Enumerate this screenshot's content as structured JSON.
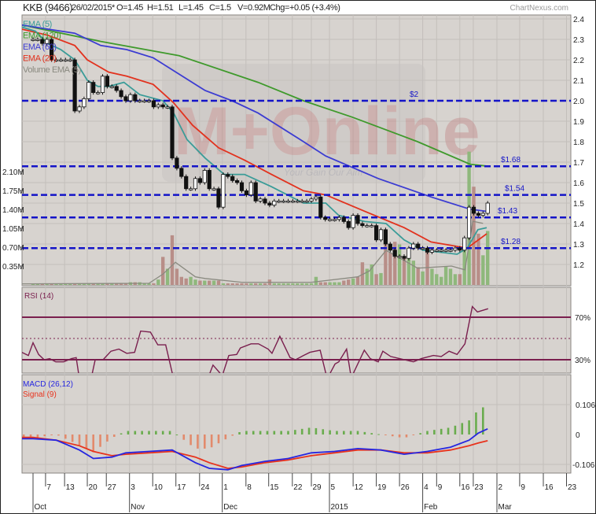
{
  "header": {
    "symbol": "KKB (9466)",
    "date": "26/02/2015*",
    "open": "O=1.45",
    "high": "H=1.51",
    "low": "L=1.45",
    "close": "C=1.5",
    "volume": "V=0.92M",
    "change": "Chg=+0.05 (+3.4%)",
    "brand": "ChartNexus.com"
  },
  "watermark": {
    "logo": "M+Online",
    "tagline": "Your Gain Our Aim"
  },
  "colors": {
    "panel_bg": "#d7d3cf",
    "grid": "#c3bfbb",
    "ema5": "#3a9c98",
    "ema120": "#3f9a2c",
    "ema60": "#3c3cd2",
    "ema20": "#e2321e",
    "vol_ema": "#8a8a80",
    "level": "#1414c8",
    "rsi": "#7a1f4e",
    "macd": "#2626e0",
    "signal": "#e8321c",
    "hist_pos": "#6aac4e",
    "hist_neg": "#e28a6c",
    "vol_up": "#8fb87c",
    "vol_down": "#b88e88"
  },
  "chart_data": [
    {
      "type": "candlestick",
      "title": "KKB (9466)",
      "x_unit": "trading day index from 1 Oct 2014",
      "legend": [
        {
          "label": "EMA (5)",
          "key": "ema5"
        },
        {
          "label": "EMA (120)",
          "key": "ema120"
        },
        {
          "label": "EMA (60)",
          "key": "ema60"
        },
        {
          "label": "EMA (20)",
          "key": "ema20"
        },
        {
          "label": "Volume EMA (5)",
          "key": "vol_ema"
        }
      ],
      "legend_placement": "top-left",
      "price_axis": {
        "ticks": [
          "2.4",
          "2.3",
          "2.2",
          "2.1",
          "2.0",
          "1.9",
          "1.8",
          "1.7",
          "1.6",
          "1.5",
          "1.4",
          "1.3",
          "1.2"
        ],
        "range": [
          1.15,
          2.42
        ]
      },
      "volume_axis": {
        "ticks": [
          "2.10M",
          "1.75M",
          "1.40M",
          "1.05M",
          "0.70M",
          "0.35M"
        ]
      },
      "levels": [
        {
          "price": 2.0,
          "label": "$2"
        },
        {
          "price": 1.68,
          "label": "$1.68"
        },
        {
          "price": 1.54,
          "label": "$1.54"
        },
        {
          "price": 1.43,
          "label": "$1.43"
        },
        {
          "price": 1.28,
          "label": "$1.28"
        }
      ],
      "closes": [
        2.3,
        2.3,
        2.28,
        2.3,
        2.2,
        2.2,
        2.2,
        2.2,
        2.2,
        1.95,
        1.97,
        2.01,
        2.09,
        2.04,
        2.04,
        2.12,
        2.07,
        2.07,
        2.05,
        2.02,
        2.0,
        2.03,
        2.0,
        2.0,
        2.0,
        2.0,
        1.97,
        1.98,
        1.97,
        1.97,
        1.72,
        1.67,
        1.63,
        1.57,
        1.57,
        1.62,
        1.6,
        1.66,
        1.57,
        1.57,
        1.48,
        1.64,
        1.63,
        1.61,
        1.6,
        1.56,
        1.54,
        1.6,
        1.51,
        1.52,
        1.5,
        1.49,
        1.51,
        1.51,
        1.51,
        1.51,
        1.51,
        1.51,
        1.51,
        1.51,
        1.52,
        1.53,
        1.43,
        1.42,
        1.42,
        1.42,
        1.43,
        1.41,
        1.38,
        1.44,
        1.4,
        1.39,
        1.39,
        1.39,
        1.32,
        1.37,
        1.3,
        1.27,
        1.24,
        1.24,
        1.23,
        1.28,
        1.3,
        1.28,
        1.28,
        1.26,
        1.27,
        1.27,
        1.27,
        1.27,
        1.27,
        1.28,
        1.27,
        1.33,
        1.48,
        1.45,
        1.44,
        1.45,
        1.5
      ],
      "volumes_m": [
        0.02,
        0.02,
        0.02,
        0.02,
        0.02,
        0.02,
        0.02,
        0.02,
        0.02,
        0.03,
        0.03,
        0.03,
        0.03,
        0.03,
        0.03,
        0.03,
        0.03,
        0.03,
        0.03,
        0.03,
        0.03,
        0.05,
        0.05,
        0.05,
        0.03,
        0.03,
        0.03,
        0.1,
        0.52,
        0.3,
        0.92,
        0.3,
        0.15,
        0.12,
        0.15,
        0.1,
        0.08,
        0.08,
        0.08,
        0.08,
        0.08,
        0.03,
        0.03,
        0.03,
        0.03,
        0.03,
        0.03,
        0.03,
        0.03,
        0.03,
        0.03,
        0.1,
        0.03,
        0.03,
        0.03,
        0.03,
        0.03,
        0.03,
        0.03,
        0.03,
        0.03,
        0.15,
        0.05,
        0.05,
        0.05,
        0.05,
        0.05,
        0.08,
        0.1,
        0.12,
        0.15,
        0.42,
        0.3,
        0.38,
        0.2,
        0.22,
        0.79,
        0.6,
        0.8,
        0.75,
        0.5,
        0.65,
        0.45,
        0.33,
        0.25,
        0.6,
        0.3,
        0.2,
        0.15,
        0.35,
        0.3,
        0.2,
        0.2,
        0.68,
        2.47,
        1.82,
        0.95,
        0.55,
        1.0
      ],
      "ema5": [
        [
          -2.4,
          2.36
        ],
        [
          0.5,
          2.34
        ],
        [
          3.2,
          2.28
        ],
        [
          6,
          2.25
        ],
        [
          9,
          2.2
        ],
        [
          11.7,
          2.1
        ],
        [
          14,
          2.07
        ],
        [
          16.3,
          2.07
        ],
        [
          19.6,
          2.09
        ],
        [
          23,
          2.03
        ],
        [
          28,
          2.0
        ],
        [
          30.3,
          1.94
        ],
        [
          33.2,
          1.81
        ],
        [
          37.1,
          1.72
        ],
        [
          41.2,
          1.64
        ],
        [
          45.6,
          1.64
        ],
        [
          51.4,
          1.58
        ],
        [
          58.3,
          1.5
        ],
        [
          63.1,
          1.5
        ],
        [
          65.9,
          1.44
        ],
        [
          71.5,
          1.41
        ],
        [
          76.1,
          1.4
        ],
        [
          80,
          1.32
        ],
        [
          84,
          1.27
        ],
        [
          91.4,
          1.25
        ],
        [
          93.6,
          1.28
        ],
        [
          95.9,
          1.37
        ],
        [
          97.8,
          1.38
        ]
      ],
      "ema20": [
        [
          -2.4,
          2.35
        ],
        [
          3.2,
          2.32
        ],
        [
          9,
          2.27
        ],
        [
          11.7,
          2.2
        ],
        [
          16.3,
          2.14
        ],
        [
          20.2,
          2.12
        ],
        [
          25.9,
          2.08
        ],
        [
          30.3,
          1.99
        ],
        [
          34.4,
          1.88
        ],
        [
          40,
          1.77
        ],
        [
          45.6,
          1.71
        ],
        [
          51.4,
          1.64
        ],
        [
          58.3,
          1.56
        ],
        [
          63.1,
          1.54
        ],
        [
          71.5,
          1.46
        ],
        [
          80,
          1.38
        ],
        [
          85.8,
          1.31
        ],
        [
          93.6,
          1.28
        ],
        [
          97.8,
          1.35
        ]
      ],
      "ema60": [
        [
          -2.4,
          2.37
        ],
        [
          3.2,
          2.35
        ],
        [
          9,
          2.33
        ],
        [
          14.6,
          2.27
        ],
        [
          20.2,
          2.25
        ],
        [
          25.9,
          2.21
        ],
        [
          31.5,
          2.13
        ],
        [
          37.1,
          2.05
        ],
        [
          42.9,
          2.0
        ],
        [
          48.5,
          1.94
        ],
        [
          58.3,
          1.8
        ],
        [
          63.1,
          1.73
        ],
        [
          74.4,
          1.62
        ],
        [
          85.8,
          1.53
        ],
        [
          94.2,
          1.47
        ],
        [
          97.6,
          1.46
        ]
      ],
      "ema120": [
        [
          -2.4,
          2.37
        ],
        [
          14.6,
          2.29
        ],
        [
          31.5,
          2.22
        ],
        [
          48.5,
          2.09
        ],
        [
          58.3,
          2.0
        ],
        [
          68.8,
          1.92
        ],
        [
          82.9,
          1.8
        ],
        [
          94.2,
          1.69
        ],
        [
          98.1,
          1.68
        ]
      ],
      "vol_ema": [
        [
          -2.4,
          0.02
        ],
        [
          25,
          0.03
        ],
        [
          28,
          0.2
        ],
        [
          30.7,
          0.42
        ],
        [
          35,
          0.15
        ],
        [
          37.1,
          0.12
        ],
        [
          45,
          0.05
        ],
        [
          60,
          0.05
        ],
        [
          70,
          0.15
        ],
        [
          72.5,
          0.26
        ],
        [
          76.1,
          0.64
        ],
        [
          82.9,
          0.31
        ],
        [
          90.2,
          0.35
        ],
        [
          93.1,
          0.28
        ],
        [
          94.8,
          1.18
        ],
        [
          97,
          1.14
        ]
      ]
    },
    {
      "type": "line",
      "title": "RSI (14)",
      "y_ticks": [
        "70%",
        "30%"
      ],
      "range": [
        0,
        100
      ],
      "series": [
        [
          -2.4,
          37
        ],
        [
          -1,
          34
        ],
        [
          0,
          46
        ],
        [
          1.2,
          35
        ],
        [
          2.4,
          30
        ],
        [
          3.6,
          31
        ],
        [
          4.9,
          28
        ],
        [
          6.6,
          28
        ],
        [
          8.3,
          31
        ],
        [
          9.3,
          32
        ],
        [
          10,
          12
        ],
        [
          12.5,
          12
        ],
        [
          13.4,
          30
        ],
        [
          15.1,
          30
        ],
        [
          16.8,
          38
        ],
        [
          18.5,
          40
        ],
        [
          20.2,
          36
        ],
        [
          21.9,
          37
        ],
        [
          23.2,
          57
        ],
        [
          25.3,
          56
        ],
        [
          26.9,
          44
        ],
        [
          28.6,
          44
        ],
        [
          30.3,
          12
        ],
        [
          36.3,
          14
        ],
        [
          38,
          16
        ],
        [
          38.8,
          25
        ],
        [
          40.8,
          15
        ],
        [
          42.2,
          34
        ],
        [
          43.9,
          35
        ],
        [
          44.7,
          41
        ],
        [
          47,
          45
        ],
        [
          48.6,
          45
        ],
        [
          50.7,
          40
        ],
        [
          51.5,
          36
        ],
        [
          53.2,
          52
        ],
        [
          55.4,
          32
        ],
        [
          56.6,
          30
        ],
        [
          58.3,
          34
        ],
        [
          59.7,
          37
        ],
        [
          60.8,
          38
        ],
        [
          61.9,
          39
        ],
        [
          63.4,
          12
        ],
        [
          65.1,
          26
        ],
        [
          65.9,
          28
        ],
        [
          67.6,
          40
        ],
        [
          68.6,
          13
        ],
        [
          71.4,
          39
        ],
        [
          72.7,
          31
        ],
        [
          74.4,
          28
        ],
        [
          75.4,
          38
        ],
        [
          77.1,
          33
        ],
        [
          79,
          31
        ],
        [
          82,
          28
        ],
        [
          83.7,
          31
        ],
        [
          86.3,
          34
        ],
        [
          88,
          33
        ],
        [
          89.7,
          38
        ],
        [
          91.4,
          35
        ],
        [
          93.1,
          45
        ],
        [
          94.7,
          80
        ],
        [
          95.8,
          75
        ],
        [
          98.1,
          78
        ]
      ]
    },
    {
      "type": "line",
      "title": "MACD (26,12)",
      "signal_title": "Signal (9)",
      "y_ticks": [
        {
          "value": 0.106,
          "label": "0.106"
        },
        {
          "value": 0,
          "label": "0"
        },
        {
          "value": -0.106,
          "label": "-0.106"
        }
      ],
      "macd": [
        [
          -2.4,
          -0.015
        ],
        [
          0,
          -0.015
        ],
        [
          5,
          -0.02
        ],
        [
          10,
          -0.055
        ],
        [
          13,
          -0.085
        ],
        [
          17,
          -0.08
        ],
        [
          20,
          -0.065
        ],
        [
          25,
          -0.06
        ],
        [
          30,
          -0.055
        ],
        [
          35,
          -0.1
        ],
        [
          38,
          -0.12
        ],
        [
          42,
          -0.125
        ],
        [
          45,
          -0.11
        ],
        [
          50,
          -0.095
        ],
        [
          55,
          -0.085
        ],
        [
          60,
          -0.065
        ],
        [
          65,
          -0.06
        ],
        [
          70,
          -0.05
        ],
        [
          75,
          -0.055
        ],
        [
          80,
          -0.07
        ],
        [
          85,
          -0.06
        ],
        [
          90,
          -0.045
        ],
        [
          94,
          -0.02
        ],
        [
          96,
          0.005
        ],
        [
          98,
          0.02
        ]
      ],
      "signal": [
        [
          -2.4,
          -0.01
        ],
        [
          0,
          -0.01
        ],
        [
          5,
          -0.02
        ],
        [
          10,
          -0.04
        ],
        [
          13,
          -0.06
        ],
        [
          17,
          -0.075
        ],
        [
          20,
          -0.07
        ],
        [
          25,
          -0.065
        ],
        [
          30,
          -0.06
        ],
        [
          35,
          -0.08
        ],
        [
          38,
          -0.1
        ],
        [
          42,
          -0.12
        ],
        [
          45,
          -0.115
        ],
        [
          50,
          -0.1
        ],
        [
          55,
          -0.09
        ],
        [
          60,
          -0.075
        ],
        [
          65,
          -0.065
        ],
        [
          70,
          -0.055
        ],
        [
          75,
          -0.055
        ],
        [
          80,
          -0.065
        ],
        [
          85,
          -0.065
        ],
        [
          90,
          -0.055
        ],
        [
          94,
          -0.04
        ],
        [
          96,
          -0.03
        ],
        [
          98,
          -0.022
        ]
      ]
    }
  ],
  "x_axis": {
    "ticks": [
      {
        "day": 2.7,
        "label": "7"
      },
      {
        "day": 6.8,
        "label": "13"
      },
      {
        "day": 11.7,
        "label": "20"
      },
      {
        "day": 15.8,
        "label": "27"
      },
      {
        "day": 20.8,
        "label": "3"
      },
      {
        "day": 25.8,
        "label": "10"
      },
      {
        "day": 30.8,
        "label": "17"
      },
      {
        "day": 35.9,
        "label": "24"
      },
      {
        "day": 40.8,
        "label": "1"
      },
      {
        "day": 45.9,
        "label": "8"
      },
      {
        "day": 50.8,
        "label": "15"
      },
      {
        "day": 55.9,
        "label": "22"
      },
      {
        "day": 60,
        "label": "29"
      },
      {
        "day": 63.9,
        "label": "5"
      },
      {
        "day": 69,
        "label": "12"
      },
      {
        "day": 74,
        "label": "19"
      },
      {
        "day": 79,
        "label": "26"
      },
      {
        "day": 84,
        "label": "4"
      },
      {
        "day": 87,
        "label": "9"
      },
      {
        "day": 92,
        "label": "16"
      },
      {
        "day": 94.9,
        "label": "23"
      },
      {
        "day": 100,
        "label": "2"
      },
      {
        "day": 104.9,
        "label": "9"
      },
      {
        "day": 110,
        "label": "16"
      },
      {
        "day": 115,
        "label": "23"
      }
    ],
    "months": [
      {
        "day": 0,
        "label": "Oct"
      },
      {
        "day": 20.8,
        "label": "Nov"
      },
      {
        "day": 40.8,
        "label": "Dec"
      },
      {
        "day": 63.9,
        "label": "2015"
      },
      {
        "day": 84,
        "label": "Feb"
      },
      {
        "day": 100,
        "label": "Mar"
      }
    ]
  }
}
